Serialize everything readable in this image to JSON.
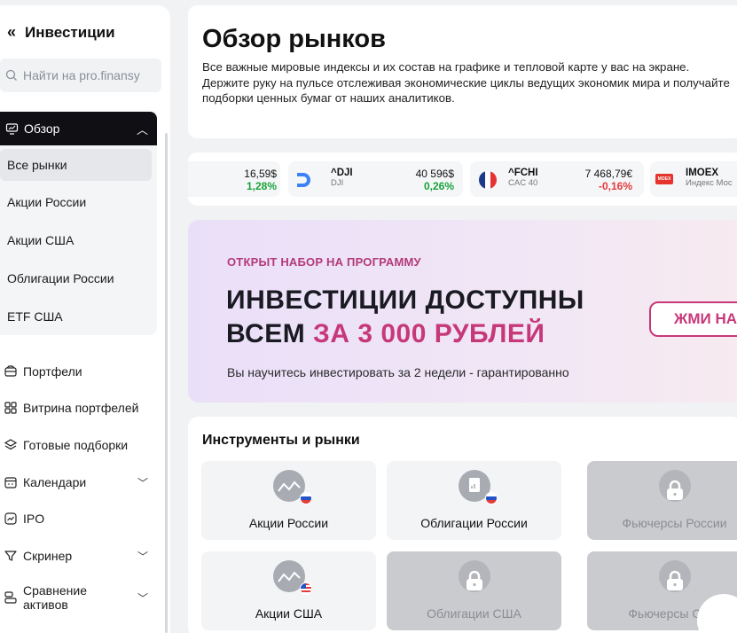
{
  "sidebar": {
    "back_label": "Инвестиции",
    "search_placeholder": "Найти на pro.finansy",
    "overview": {
      "label": "Обзор",
      "items": [
        "Все рынки",
        "Акции России",
        "Акции США",
        "Облигации России",
        "ETF США"
      ]
    },
    "nav": [
      {
        "label": "Портфели",
        "icon": "wallet-icon"
      },
      {
        "label": "Витрина портфелей",
        "icon": "grid-icon"
      },
      {
        "label": "Готовые подборки",
        "icon": "layers-icon"
      },
      {
        "label": "Календари",
        "icon": "calendar-icon"
      },
      {
        "label": "IPO",
        "icon": "chart-icon"
      },
      {
        "label": "Скринер",
        "icon": "filter-icon"
      },
      {
        "label": "Сравнение",
        "label2": "активов",
        "icon": "compare-icon"
      }
    ]
  },
  "hero": {
    "title": "Обзор рынков",
    "description": "Все важные мировые индексы и их состав на графике и тепловой карте у вас на экране. Держите руку на пульсе отслеживая экономические циклы ведущих экономик мира и получайте подборки ценных бумаг от наших аналитиков."
  },
  "ticker": [
    {
      "value": "16,59$",
      "change": "1,28%"
    },
    {
      "name": "^DJI",
      "sub": "DJI",
      "value": "40 596$",
      "change": "0,26%"
    },
    {
      "name": "^FCHI",
      "sub": "CAC 40",
      "value": "7 468,79€",
      "change": "-0,16%"
    },
    {
      "name": "IMOEX",
      "sub": "Индекс Мос",
      "logo_text": "MOEX"
    }
  ],
  "promo": {
    "kicker": "ОТКРЫТ НАБОР НА ПРОГРАММУ",
    "headline_line1": "ИНВЕСТИЦИИ ДОСТУПНЫ",
    "headline_line2_a": "ВСЕМ ",
    "headline_line2_b": "ЗА 3 000 РУБЛЕЙ",
    "note": "Вы научитесь инвестировать за 2 недели - гарантированно",
    "cta": "ЖМИ НА"
  },
  "tools": {
    "heading": "Инструменты и рынки",
    "cards": [
      {
        "label": "Акции России",
        "locked": false
      },
      {
        "label": "Облигации России",
        "locked": false
      },
      {
        "label": "Фьючерсы России",
        "locked": true
      },
      {
        "label": "Акции США",
        "locked": false
      },
      {
        "label": "Облигации США",
        "locked": true
      },
      {
        "label": "Фьючерсы США",
        "locked": true
      }
    ]
  },
  "colors": {
    "accent": "#c7387a",
    "positive": "#19a33a",
    "negative": "#e43a3a",
    "dark": "#0f0f14"
  }
}
